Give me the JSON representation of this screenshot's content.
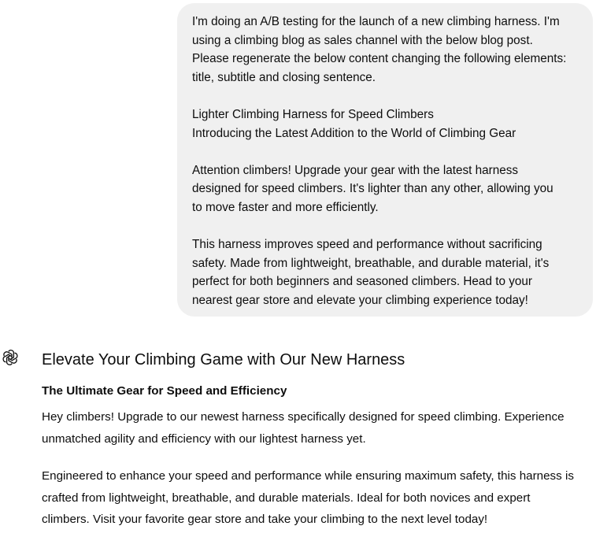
{
  "user_message": {
    "intro_lines": [
      "I'm doing an A/B testing for the launch of a new climbing harness. I'm",
      "using a climbing blog as sales channel with the below blog post.",
      "Please regenerate the below content changing the following elements:",
      "title, subtitle and closing sentence."
    ],
    "title": "Lighter Climbing Harness for Speed Climbers",
    "subtitle": "Introducing the Latest Addition to the World of Climbing Gear",
    "body1_lines": [
      "Attention climbers! Upgrade your gear with the latest harness",
      "designed for speed climbers. It's lighter than any other, allowing you",
      "to move faster and more efficiently."
    ],
    "body2_lines": [
      "This harness improves speed and performance without sacrificing",
      "safety. Made from lightweight, breathable, and durable material, it's",
      "perfect for both beginners and seasoned climbers. Head to your",
      "nearest gear store and elevate your climbing experience today!"
    ]
  },
  "assistant_message": {
    "avatar_icon": "openai-logo-icon",
    "title": "Elevate Your Climbing Game with Our New Harness",
    "subtitle": "The Ultimate Gear for Speed and Efficiency",
    "para1_lines": [
      "Hey climbers! Upgrade to our newest harness specifically designed for speed climbing. Experience",
      "unmatched agility and efficiency with our lightest harness yet."
    ],
    "para2_lines": [
      "Engineered to enhance your speed and performance while ensuring maximum safety, this harness is",
      "crafted from lightweight, breathable, and durable materials. Ideal for both novices and expert",
      "climbers. Visit your favorite gear store and take your climbing to the next level today!"
    ]
  },
  "colors": {
    "user_bubble_bg": "#f0f0f0",
    "text": "#0d0d0d",
    "page_bg": "#ffffff"
  }
}
